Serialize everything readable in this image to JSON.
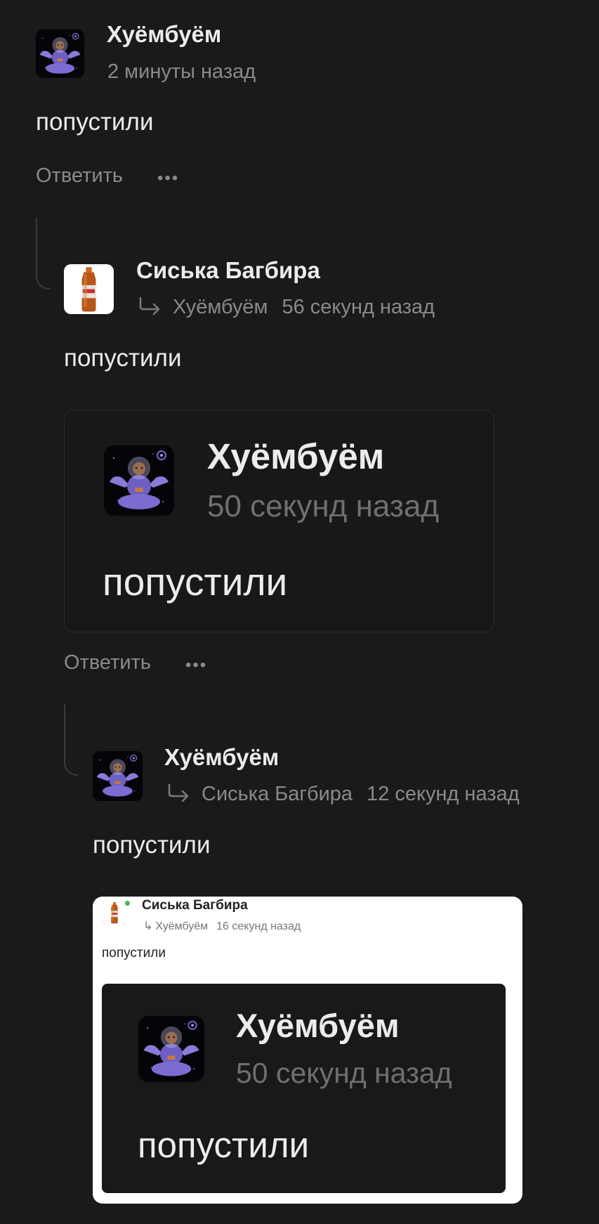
{
  "colors": {
    "background": "#1a1a1a",
    "text": "#ececec",
    "muted": "#8a8a8a",
    "online": "#3fbf4a"
  },
  "comments": [
    {
      "author": "Хуёмбуём",
      "time": "2 минуты назад",
      "text": "попустили",
      "reply_label": "Ответить",
      "more_label": "•••",
      "avatar_icon": "astronaut-monkey-avatar"
    },
    {
      "author": "Сиська Багбира",
      "reply_to": "Хуёмбуём",
      "time": "56 секунд назад",
      "text": "попустили",
      "reply_label": "Ответить",
      "more_label": "•••",
      "avatar_icon": "beer-bottle-avatar",
      "quote": {
        "author": "Хуёмбуём",
        "time": "50 секунд назад",
        "text": "попустили"
      }
    },
    {
      "author": "Хуёмбуём",
      "reply_to": "Сиська Багбира",
      "time": "12 секунд назад",
      "text": "попустили",
      "avatar_icon": "astronaut-monkey-avatar",
      "screenshot": {
        "author": "Сиська Багбира",
        "reply_to": "Хуёмбуём",
        "time": "16 секунд назад",
        "text": "попустили",
        "quote": {
          "author": "Хуёмбуём",
          "time": "50 секунд назад",
          "text": "попустили"
        }
      }
    }
  ]
}
